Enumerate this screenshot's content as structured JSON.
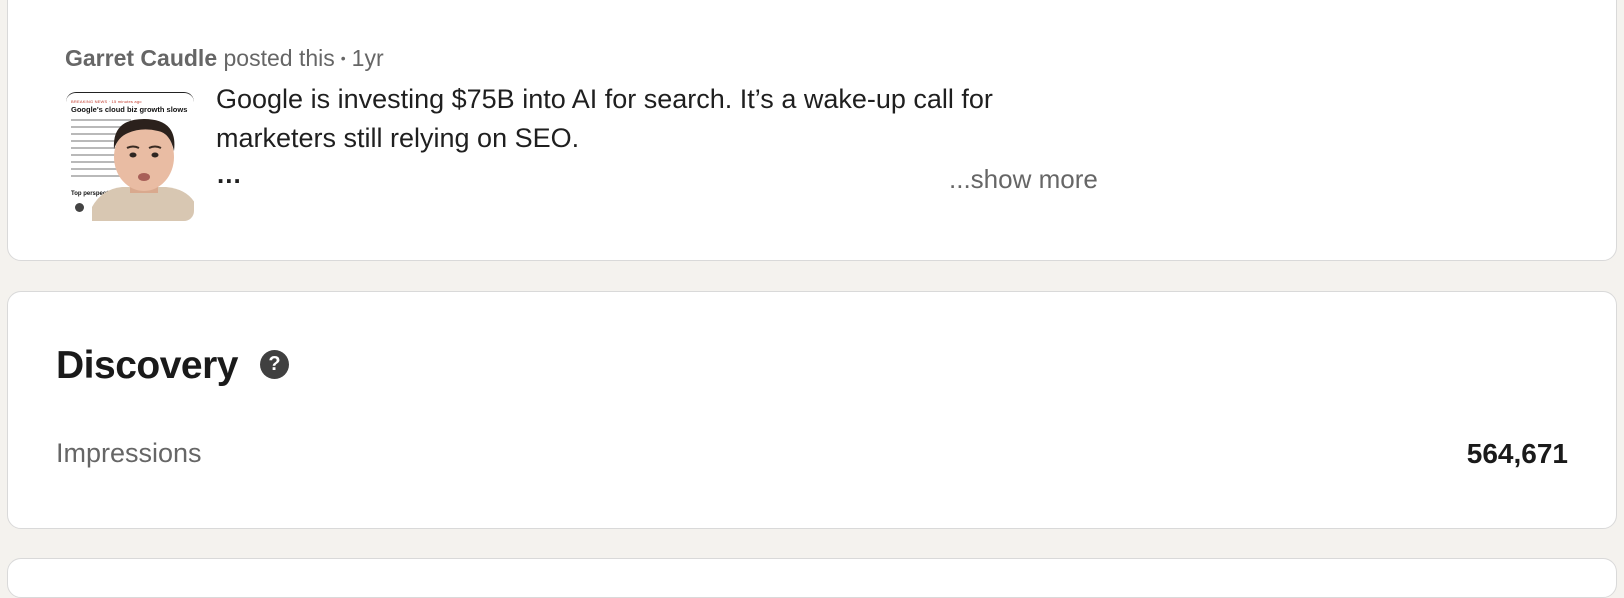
{
  "post": {
    "author": "Garret Caudle",
    "action": "posted this",
    "separator": "•",
    "age": "1yr",
    "text": "Google is investing $75B into AI for search. It’s a wake-up call for marketers still relying on SEO.",
    "ellipsis": "...",
    "show_more": "...show more",
    "thumbnail": {
      "article_tag": "BREAKING NEWS · 15 minutes ago",
      "article_title": "Google's cloud biz growth slows",
      "article_section": "Top perspectives"
    }
  },
  "discovery": {
    "title": "Discovery",
    "help_icon": "question-circle-icon",
    "metrics": [
      {
        "label": "Impressions",
        "value": "564,671"
      }
    ]
  }
}
